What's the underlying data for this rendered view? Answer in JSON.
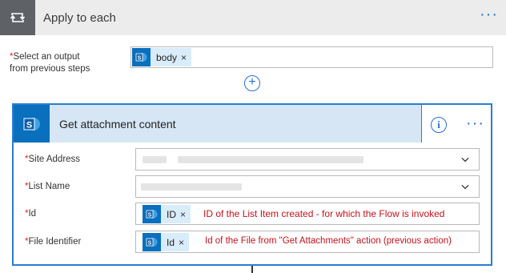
{
  "loop": {
    "title": "Apply to each",
    "more": "···",
    "select_label_line1": "Select an output",
    "select_label_line2": "from previous steps",
    "required_mark": "*",
    "token": {
      "icon": "sharepoint-icon",
      "label": "body",
      "remove": "×"
    }
  },
  "add_step": "+",
  "card": {
    "title": "Get attachment content",
    "icon": "sharepoint-icon",
    "info": "i",
    "more": "···",
    "fields": [
      {
        "label": "Site Address",
        "value": ""
      },
      {
        "label": "List Name",
        "value": ""
      },
      {
        "label": "Id",
        "token": "ID",
        "remove": "×",
        "note": "ID of the List Item created - for which the Flow is invoked"
      },
      {
        "label": "File Identifier",
        "token": "Id",
        "remove": "×",
        "note": "Id of the File from \"Get Attachments\" action (previous action)"
      }
    ]
  },
  "colors": {
    "accent": "#2a6fd6",
    "sharepoint": "#0a6fbd",
    "annotation": "#c1121f"
  }
}
